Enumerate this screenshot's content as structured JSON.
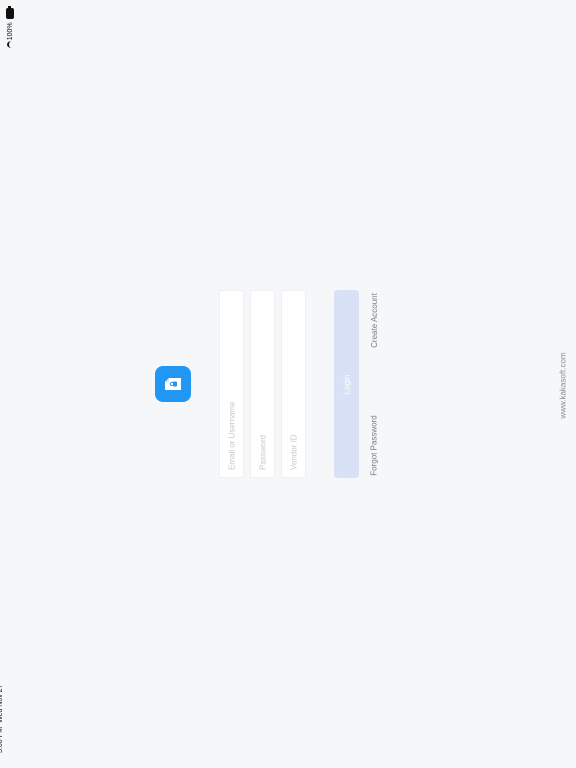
{
  "status": {
    "battery": "100%",
    "time": "5:00 PM",
    "date": "Wed Nov 27"
  },
  "login_form": {
    "email_placeholder": "Email or Username",
    "password_placeholder": "Password",
    "vendor_placeholder": "Vendor ID",
    "login_label": "Login",
    "forgot_label": "Forgot Password",
    "create_label": "Create Account"
  },
  "footer": {
    "website": "www.kakasoft.com"
  },
  "colors": {
    "background": "#f6f7f9",
    "app_icon": "#2196f3",
    "login_button": "#d9e1f7"
  }
}
